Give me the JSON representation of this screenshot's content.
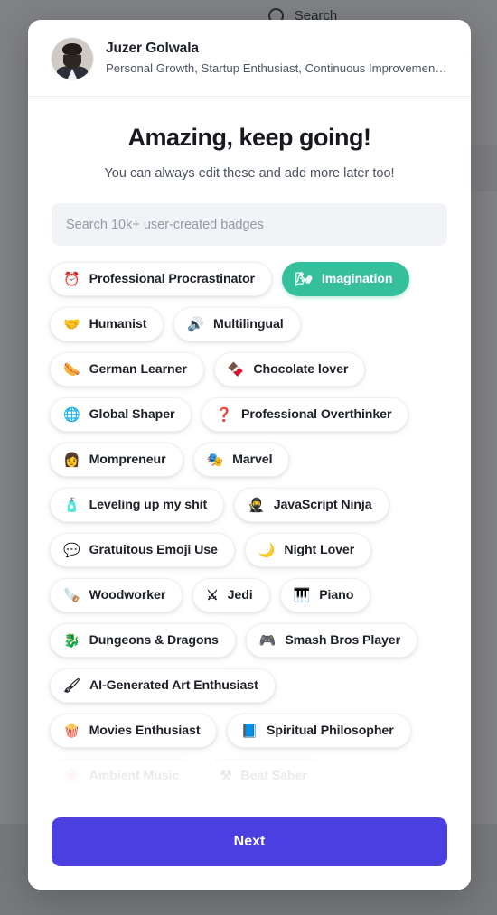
{
  "background": {
    "search_label": "Search",
    "search_icon": "magnifier-icon"
  },
  "modal": {
    "profile": {
      "name": "Juzer Golwala",
      "subtitle": "Personal Growth, Startup Enthusiast, Continuous Improvement, …",
      "avatar_alt": "avatar"
    },
    "title": "Amazing, keep going!",
    "subtitle": "You can always edit these and add more later too!",
    "search": {
      "placeholder": "Search 10k+ user-created badges",
      "value": ""
    },
    "footer": {
      "next_label": "Next"
    },
    "colors": {
      "selected_badge": "#36bf9d",
      "next_button": "#4b3fe0",
      "overlay": "#1a1c20",
      "search_field": "#f1f3f6"
    },
    "badges": [
      {
        "label": "Professional Procrastinator",
        "emoji": "⏰",
        "icon": "alarm-clock-icon",
        "selected": false,
        "faded": false
      },
      {
        "label": "Imagination",
        "emoji": "🌬",
        "icon": "wind-cloud-icon",
        "selected": true,
        "faded": false
      },
      {
        "label": "Humanist",
        "emoji": "🤝",
        "icon": "handshake-icon",
        "selected": false,
        "faded": false
      },
      {
        "label": "Multilingual",
        "emoji": "🔊",
        "icon": "speaker-icon",
        "selected": false,
        "faded": false
      },
      {
        "label": "German Learner",
        "emoji": "🌭",
        "icon": "hotdog-icon",
        "selected": false,
        "faded": false
      },
      {
        "label": "Chocolate lover",
        "emoji": "🍫",
        "icon": "chocolate-bar-icon",
        "selected": false,
        "faded": false
      },
      {
        "label": "Global Shaper",
        "emoji": "🌐",
        "icon": "globe-icon",
        "selected": false,
        "faded": false
      },
      {
        "label": "Professional Overthinker",
        "emoji": "❓",
        "icon": "question-mark-icon",
        "selected": false,
        "faded": false
      },
      {
        "label": "Mompreneur",
        "emoji": "👩",
        "icon": "woman-icon",
        "selected": false,
        "faded": false
      },
      {
        "label": "Marvel",
        "emoji": "🎭",
        "icon": "mask-icon",
        "selected": false,
        "faded": false
      },
      {
        "label": "Leveling up my shit",
        "emoji": "🧴",
        "icon": "lotion-bottle-icon",
        "selected": false,
        "faded": false
      },
      {
        "label": "JavaScript Ninja",
        "emoji": "🥷",
        "icon": "ninja-icon",
        "selected": false,
        "faded": false
      },
      {
        "label": "Gratuitous Emoji Use",
        "emoji": "💬",
        "icon": "speech-bubble-icon",
        "selected": false,
        "faded": false
      },
      {
        "label": "Night Lover",
        "emoji": "🌙",
        "icon": "crescent-moon-icon",
        "selected": false,
        "faded": false
      },
      {
        "label": "Woodworker",
        "emoji": "🪚",
        "icon": "saw-icon",
        "selected": false,
        "faded": false
      },
      {
        "label": "Jedi",
        "emoji": "⚔",
        "icon": "lightsaber-icon",
        "selected": false,
        "faded": false
      },
      {
        "label": "Piano",
        "emoji": "🎹",
        "icon": "piano-icon",
        "selected": false,
        "faded": false
      },
      {
        "label": "Dungeons & Dragons",
        "emoji": "🐉",
        "icon": "dragon-icon",
        "selected": false,
        "faded": false
      },
      {
        "label": "Smash Bros Player",
        "emoji": "🎮",
        "icon": "game-controller-icon",
        "selected": false,
        "faded": false
      },
      {
        "label": "AI-Generated Art Enthusiast",
        "emoji": "🖌",
        "icon": "paintbrush-icon",
        "selected": false,
        "faded": false
      },
      {
        "label": "Movies Enthusiast",
        "emoji": "🍿",
        "icon": "popcorn-icon",
        "selected": false,
        "faded": false
      },
      {
        "label": "Spiritual Philosopher",
        "emoji": "📘",
        "icon": "open-book-icon",
        "selected": false,
        "faded": false
      },
      {
        "label": "Ambient Music",
        "emoji": "🌸",
        "icon": "blossom-icon",
        "selected": false,
        "faded": true
      },
      {
        "label": "Beat Saber",
        "emoji": "⚒",
        "icon": "crossed-sabers-icon",
        "selected": false,
        "faded": true
      }
    ]
  }
}
